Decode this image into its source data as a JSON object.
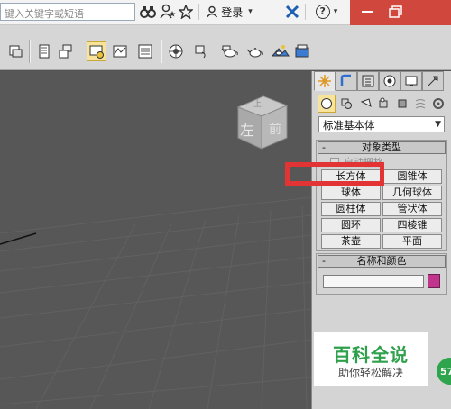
{
  "browser_bar": {
    "search_placeholder": "键入关键字或短语",
    "login_label": "登录",
    "help_label": "?",
    "icons": [
      "binoculars-icon",
      "star-person-icon",
      "star-icon",
      "user-icon",
      "exchange-x-icon",
      "help-icon",
      "minimize-icon",
      "maximize-icon"
    ]
  },
  "toolbar": {
    "icons": [
      "layers-icon",
      "curve-editor-icon",
      "schematic-icon",
      "material-editor-icon",
      "render-setup-icon",
      "rendered-frame-icon",
      "render-icon",
      "teapot-icon",
      "render-production-icon",
      "environment-icon"
    ],
    "active_icon": "material-editor-icon"
  },
  "viewport": {
    "viewcube_face": "前",
    "viewcube_side": "左",
    "viewcube_top": "上"
  },
  "command_panel": {
    "tabs": [
      "create-tab",
      "modify-tab",
      "hierarchy-tab",
      "motion-tab",
      "display-tab",
      "utilities-tab"
    ],
    "categories": [
      "geometry",
      "shapes",
      "lights",
      "cameras",
      "helpers",
      "space-warps",
      "systems"
    ],
    "dropdown_value": "标准基本体",
    "object_type": {
      "header": "对象类型",
      "collapse": "-",
      "autogrid_label": "自动栅格",
      "buttons": [
        {
          "label": "长方体"
        },
        {
          "label": "圆锥体"
        },
        {
          "label": "球体"
        },
        {
          "label": "几何球体"
        },
        {
          "label": "圆柱体"
        },
        {
          "label": "管状体"
        },
        {
          "label": "圆环"
        },
        {
          "label": "四棱锥"
        },
        {
          "label": "茶壶"
        },
        {
          "label": "平面"
        }
      ]
    },
    "name_color": {
      "header": "名称和颜色",
      "collapse": "-",
      "name_value": "",
      "color": "#c0348c"
    }
  },
  "watermark": {
    "title": "百科全说",
    "subtitle": "助你轻松解决"
  },
  "badge": {
    "text": "57"
  },
  "colors": {
    "accent_red": "#e23434",
    "titlebar_red": "#d0473d",
    "watermark_green": "#2fa14d"
  }
}
